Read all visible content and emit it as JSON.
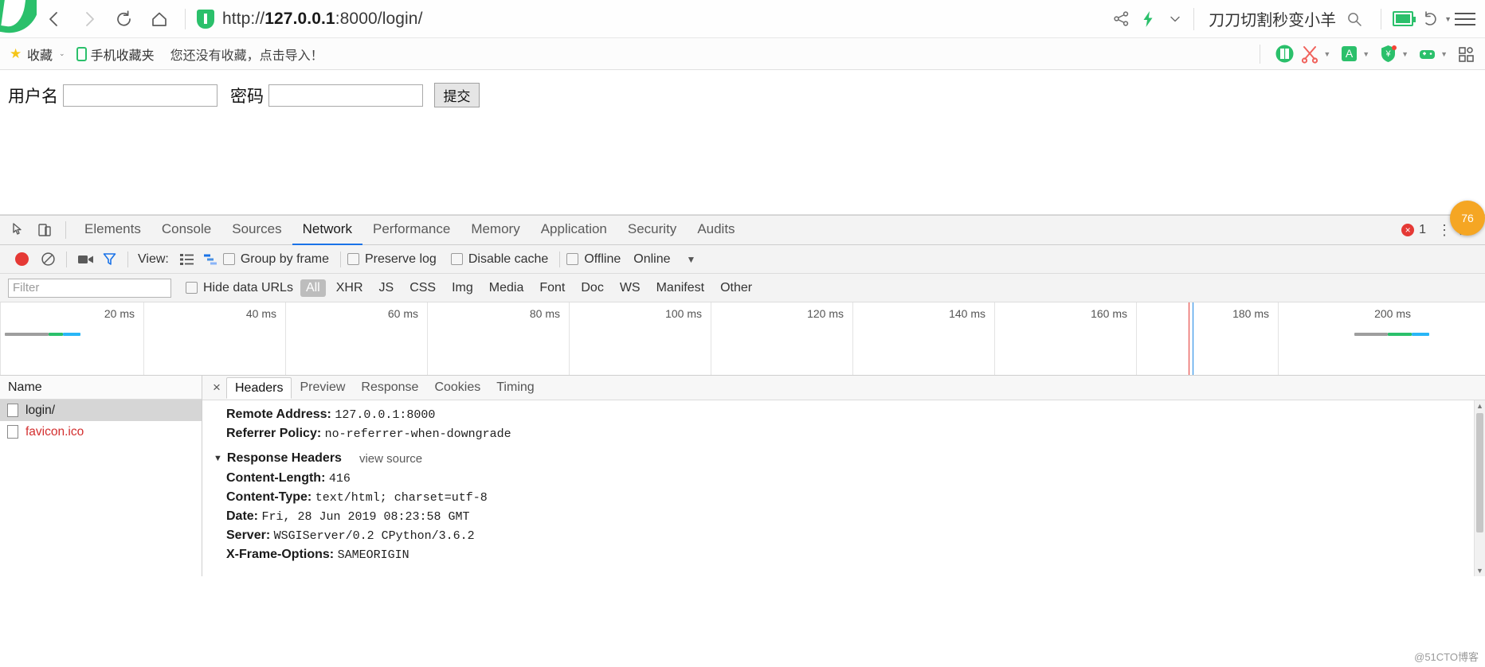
{
  "browser": {
    "nav": {
      "back_label": "Back",
      "forward_label": "Forward",
      "reload_label": "Reload",
      "home_label": "Home"
    },
    "url": {
      "scheme": "http://",
      "host": "127.0.0.1",
      "rest": ":8000/login/",
      "full": "http://127.0.0.1:8000/login/"
    },
    "right_tools": {
      "share_icon": "share-icon",
      "lightning_icon": "lightning-icon",
      "chevron_icon": "chevron-down-icon",
      "search_text": "刀刀切割秒变小羊",
      "search_icon": "search-icon",
      "battery_icon": "battery-icon",
      "undo_icon": "undo-icon",
      "menu_icon": "hamburger-menu-icon"
    }
  },
  "bookmarks": {
    "favorites_label": "收藏",
    "mobile_label": "手机收藏夹",
    "hint": "您还没有收藏，点击导入！",
    "extensions": [
      {
        "name": "book-extension-icon",
        "glyph": "📕",
        "has_caret": false
      },
      {
        "name": "scissors-extension-icon",
        "glyph": "✂",
        "has_caret": true
      },
      {
        "name": "translate-extension-icon",
        "glyph": "A",
        "has_caret": true
      },
      {
        "name": "coupon-extension-icon",
        "glyph": "¥",
        "has_caret": true
      },
      {
        "name": "game-extension-icon",
        "glyph": "🎮",
        "has_caret": true
      },
      {
        "name": "apps-grid-icon",
        "glyph": "▣",
        "has_caret": false
      }
    ]
  },
  "page": {
    "username_label": "用户名",
    "username_value": "",
    "username_placeholder": "",
    "password_label": "密码",
    "password_value": "",
    "password_placeholder": "",
    "submit_label": "提交"
  },
  "devtools": {
    "inspect_icon": "inspect-element-icon",
    "device_icon": "device-toolbar-icon",
    "tabs": [
      {
        "label": "Elements",
        "active": false
      },
      {
        "label": "Console",
        "active": false
      },
      {
        "label": "Sources",
        "active": false
      },
      {
        "label": "Network",
        "active": true
      },
      {
        "label": "Performance",
        "active": false
      },
      {
        "label": "Memory",
        "active": false
      },
      {
        "label": "Application",
        "active": false
      },
      {
        "label": "Security",
        "active": false
      },
      {
        "label": "Audits",
        "active": false
      }
    ],
    "error_count": "1",
    "more_icon": "kebab-menu-icon",
    "close_icon": "close-icon",
    "network_toolbar": {
      "record_icon": "record-button",
      "clear_icon": "clear-icon",
      "camera_icon": "camera-icon",
      "filter_icon": "filter-funnel-icon",
      "view_label": "View:",
      "list_view_icon": "list-view-icon",
      "waterfall_view_icon": "waterfall-view-icon",
      "group_by_frame": "Group by frame",
      "preserve_log": "Preserve log",
      "disable_cache": "Disable cache",
      "offline": "Offline",
      "online": "Online",
      "throttle_caret": "▼"
    },
    "filter_bar": {
      "placeholder": "Filter",
      "value": "",
      "hide_data_urls": "Hide data URLs",
      "types": [
        {
          "label": "All",
          "selected": true
        },
        {
          "label": "XHR",
          "selected": false
        },
        {
          "label": "JS",
          "selected": false
        },
        {
          "label": "CSS",
          "selected": false
        },
        {
          "label": "Img",
          "selected": false
        },
        {
          "label": "Media",
          "selected": false
        },
        {
          "label": "Font",
          "selected": false
        },
        {
          "label": "Doc",
          "selected": false
        },
        {
          "label": "WS",
          "selected": false
        },
        {
          "label": "Manifest",
          "selected": false
        },
        {
          "label": "Other",
          "selected": false
        }
      ]
    },
    "overview": {
      "ticks": [
        "20 ms",
        "40 ms",
        "60 ms",
        "80 ms",
        "100 ms",
        "120 ms",
        "140 ms",
        "160 ms",
        "180 ms",
        "200 ms"
      ]
    },
    "requests": {
      "column_name": "Name",
      "rows": [
        {
          "name": "login/",
          "selected": true,
          "error": false
        },
        {
          "name": "favicon.ico",
          "selected": false,
          "error": true
        }
      ]
    },
    "detail": {
      "close_label": "×",
      "tabs": [
        {
          "label": "Headers",
          "active": true
        },
        {
          "label": "Preview",
          "active": false
        },
        {
          "label": "Response",
          "active": false
        },
        {
          "label": "Cookies",
          "active": false
        },
        {
          "label": "Timing",
          "active": false
        }
      ],
      "top_rows": [
        {
          "key": "Remote Address:",
          "value": "127.0.0.1:8000"
        },
        {
          "key": "Referrer Policy:",
          "value": "no-referrer-when-downgrade"
        }
      ],
      "response_section": {
        "title": "Response Headers",
        "view_source": "view source",
        "rows": [
          {
            "key": "Content-Length:",
            "value": "416"
          },
          {
            "key": "Content-Type:",
            "value": "text/html; charset=utf-8"
          },
          {
            "key": "Date:",
            "value": "Fri, 28 Jun 2019 08:23:58 GMT"
          },
          {
            "key": "Server:",
            "value": "WSGIServer/0.2 CPython/3.6.2"
          },
          {
            "key": "X-Frame-Options:",
            "value": "SAMEORIGIN"
          }
        ]
      }
    }
  },
  "overlay": {
    "badge_text": "76",
    "watermark": "@51CTO博客"
  },
  "colors": {
    "brand_green": "#2bc06b",
    "accent_blue": "#1a73e8",
    "error_red": "#d32f2f",
    "record_red": "#e53935"
  }
}
